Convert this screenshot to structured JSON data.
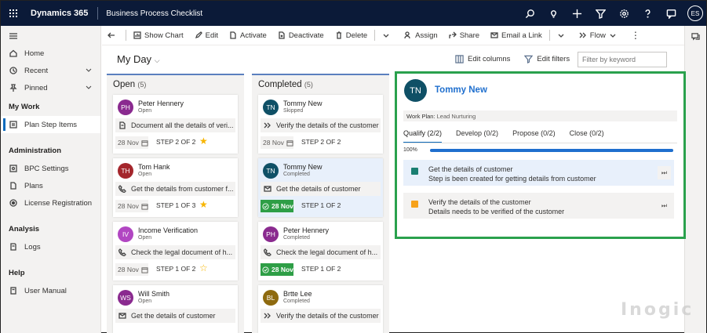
{
  "topbar": {
    "brand": "Dynamics 365",
    "app_title": "Business Process Checklist",
    "user_initials": "ES"
  },
  "nav": {
    "top": [
      {
        "label": "Home",
        "icon": "home-icon"
      },
      {
        "label": "Recent",
        "icon": "clock-icon"
      },
      {
        "label": "Pinned",
        "icon": "pin-icon"
      }
    ],
    "sections": [
      {
        "title": "My Work",
        "items": [
          {
            "label": "Plan Step Items",
            "icon": "list-icon",
            "active": true
          }
        ]
      },
      {
        "title": "Administration",
        "items": [
          {
            "label": "BPC Settings",
            "icon": "settings-icon"
          },
          {
            "label": "Plans",
            "icon": "document-icon"
          },
          {
            "label": "License Registration",
            "icon": "license-icon"
          }
        ]
      },
      {
        "title": "Analysis",
        "items": [
          {
            "label": "Logs",
            "icon": "log-icon"
          }
        ]
      },
      {
        "title": "Help",
        "items": [
          {
            "label": "User Manual",
            "icon": "manual-icon"
          }
        ]
      }
    ]
  },
  "commands": {
    "show_chart": "Show Chart",
    "edit": "Edit",
    "activate": "Activate",
    "deactivate": "Deactivate",
    "delete": "Delete",
    "assign": "Assign",
    "share": "Share",
    "email_link": "Email a Link",
    "flow": "Flow"
  },
  "view": {
    "title": "My Day",
    "edit_columns": "Edit columns",
    "edit_filters": "Edit filters",
    "filter_placeholder": "Filter by keyword"
  },
  "columns": [
    {
      "title": "Open",
      "count": "(5)",
      "cards": [
        {
          "initials": "PH",
          "color": "#8a2a8f",
          "name": "Peter Hennery",
          "status": "Open",
          "task": "Document all the details of veri...",
          "task_icon": "document",
          "date": "28 Nov",
          "step": "STEP 2 OF 2",
          "star": "filled"
        },
        {
          "initials": "TH",
          "color": "#a4262c",
          "name": "Tom Hank",
          "status": "Open",
          "task": "Get the details from customer f...",
          "task_icon": "phone",
          "date": "28 Nov",
          "step": "STEP 1 OF 3",
          "star": "filled"
        },
        {
          "initials": "IV",
          "color": "#b146c2",
          "name": "Income Verification",
          "status": "Open",
          "task": "Check the legal document of h...",
          "task_icon": "phone",
          "date": "28 Nov",
          "step": "STEP 1 OF 2",
          "star": "outline"
        },
        {
          "initials": "WS",
          "color": "#8a2a8f",
          "name": "Will Smith",
          "status": "Open",
          "task": "Get the details of customer",
          "task_icon": "mail",
          "date": "",
          "step": "",
          "star": ""
        }
      ]
    },
    {
      "title": "Completed",
      "count": "(5)",
      "cards": [
        {
          "initials": "TN",
          "color": "#0f5066",
          "name": "Tommy New",
          "status": "Skipped",
          "task": "Verify the details of the customer",
          "task_icon": "skip",
          "date": "28 Nov",
          "step": "STEP 2 OF 2",
          "done": false
        },
        {
          "initials": "TN",
          "color": "#0f5066",
          "name": "Tommy New",
          "status": "Completed",
          "task": "Get the details of customer",
          "task_icon": "mail",
          "date": "28 Nov",
          "step": "STEP 1 OF 2",
          "done": true,
          "selected": true
        },
        {
          "initials": "PH",
          "color": "#8a2a8f",
          "name": "Peter Hennery",
          "status": "Completed",
          "task": "Check the legal document of h...",
          "task_icon": "phone",
          "date": "28 Nov",
          "step": "STEP 1 OF 2",
          "done": true
        },
        {
          "initials": "BL",
          "color": "#8e6a0f",
          "name": "Brtte Lee",
          "status": "Completed",
          "task": "Verify the details of the customer",
          "task_icon": "skip",
          "date": "",
          "step": "",
          "done": true
        }
      ]
    }
  ],
  "detail": {
    "initials": "TN",
    "name": "Tommy New",
    "work_plan_label": "Work Plan:",
    "work_plan_value": "Lead Nurturing",
    "tabs": [
      "Qualify (2/2)",
      "Develop (0/2)",
      "Propose (0/2)",
      "Close (0/2)"
    ],
    "progress_label": "100%",
    "progress": 1.0,
    "steps": [
      {
        "title": "Get the details of customer",
        "desc": "Step is been created for getting details from customer",
        "check_color": "#1a7f72",
        "bg": "#e8f0fb"
      },
      {
        "title": "Verify the details of the customer",
        "desc": "Details needs to be verified of the customer",
        "check_color": "#f7a21b",
        "bg": "#f3f2f1"
      }
    ]
  },
  "watermark": "Inogic"
}
